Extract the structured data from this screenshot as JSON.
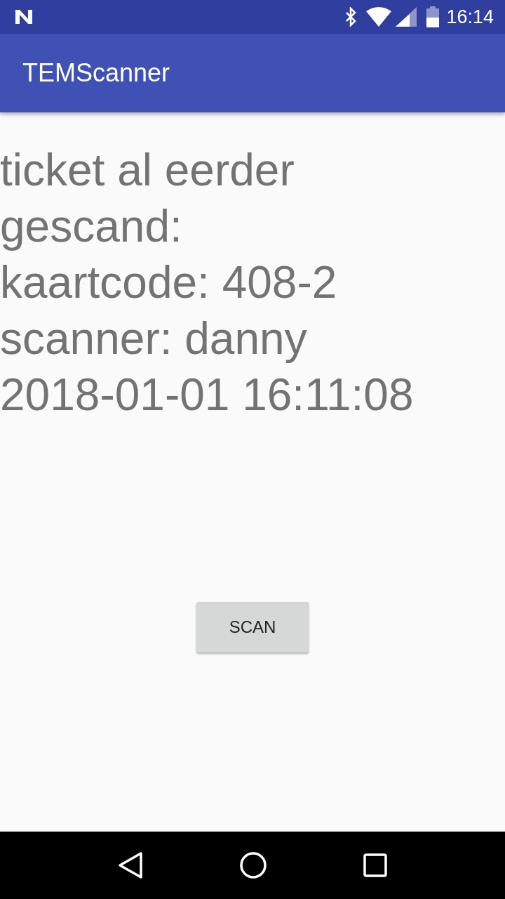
{
  "status_bar": {
    "time": "16:14"
  },
  "app_bar": {
    "title": "TEMScanner"
  },
  "message_lines": [
    "ticket al eerder",
    "gescand:",
    "kaartcode: 408-2",
    "scanner: danny",
    "2018-01-01 16:11:08"
  ],
  "scan_button": {
    "label": "SCAN"
  }
}
